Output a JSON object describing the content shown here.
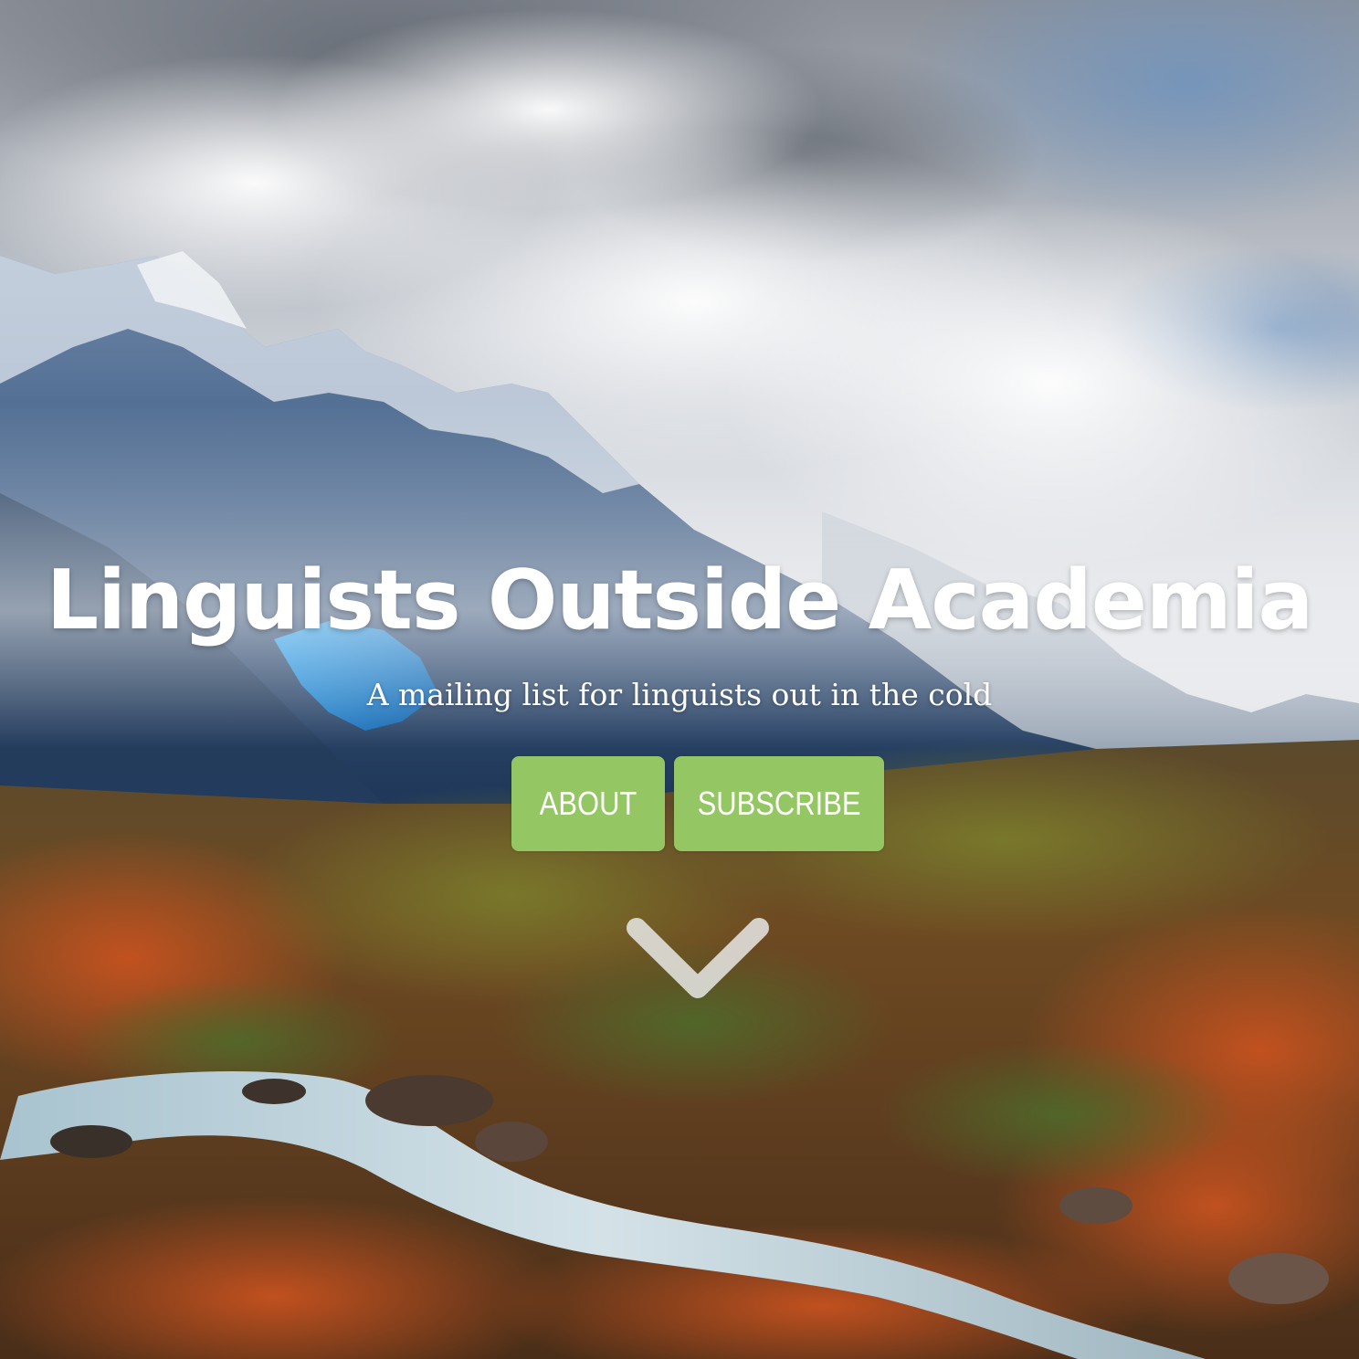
{
  "hero": {
    "title": "Linguists Outside Academia",
    "subtitle": "A mailing list for linguists out in the cold",
    "background_icon": "mountain-landscape-photo",
    "buttons": [
      {
        "label": "ABOUT"
      },
      {
        "label": "SUBSCRIBE"
      }
    ],
    "scroll_icon": "chevron-down-icon"
  },
  "colors": {
    "button": "#94c764",
    "text": "#ffffff"
  }
}
